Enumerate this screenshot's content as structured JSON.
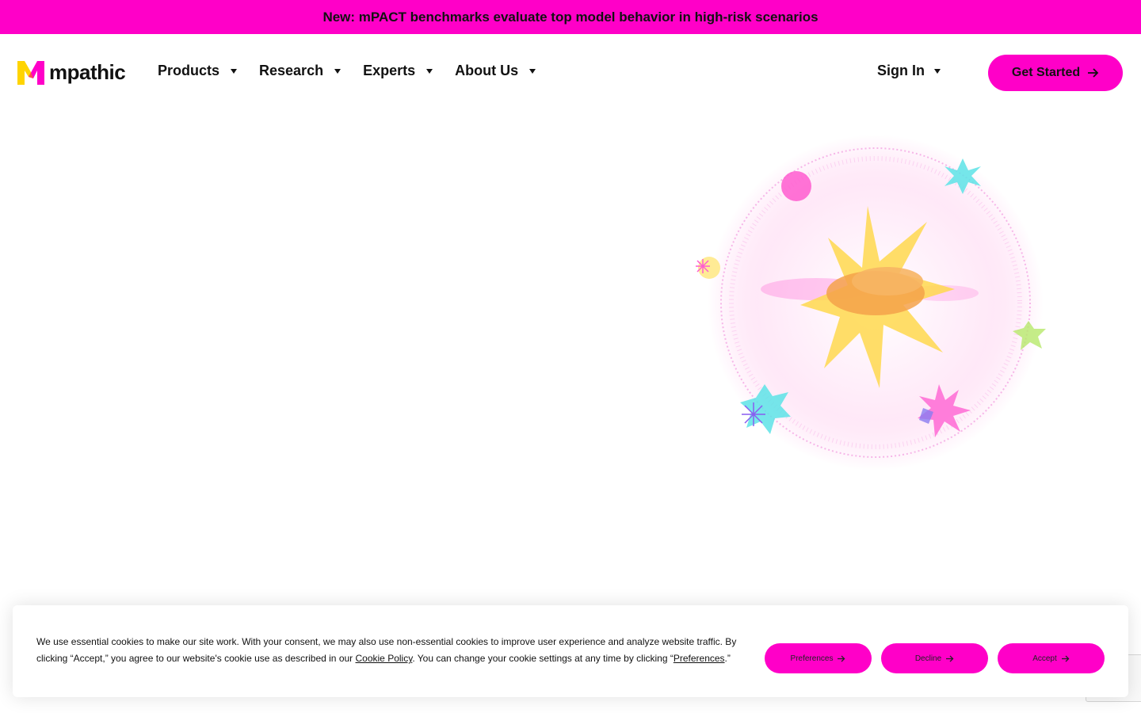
{
  "announcement": {
    "text": "New: mPACT benchmarks evaluate top model behavior in high-risk scenarios"
  },
  "header": {
    "logo_text": "mpathic",
    "menu": [
      {
        "label": "Products"
      },
      {
        "label": "Research"
      },
      {
        "label": "Experts"
      },
      {
        "label": "About Us"
      }
    ],
    "signin_label": "Sign In",
    "cta_label": "Get Started"
  },
  "cookie_banner": {
    "text_part1": "We use essential cookies to make our site work. With your consent, we may also use non-essential cookies to improve user experience and analyze website traffic. By clicking “Accept,” you agree to our website's cookie use as described in our ",
    "cookie_policy_link": "Cookie Policy",
    "text_part2": ". You can change your cookie settings at any time by clicking “",
    "preferences_link": "Preferences",
    "text_part3": ".”",
    "buttons": {
      "preferences": "Preferences",
      "decline": "Decline",
      "accept": "Accept"
    }
  },
  "colors": {
    "brand_pink": "#ff00c8",
    "brand_yellow": "#ffd400",
    "text": "#111111"
  },
  "icons": [
    "caret-down-icon",
    "arrow-right-icon",
    "mpathic-logo"
  ]
}
